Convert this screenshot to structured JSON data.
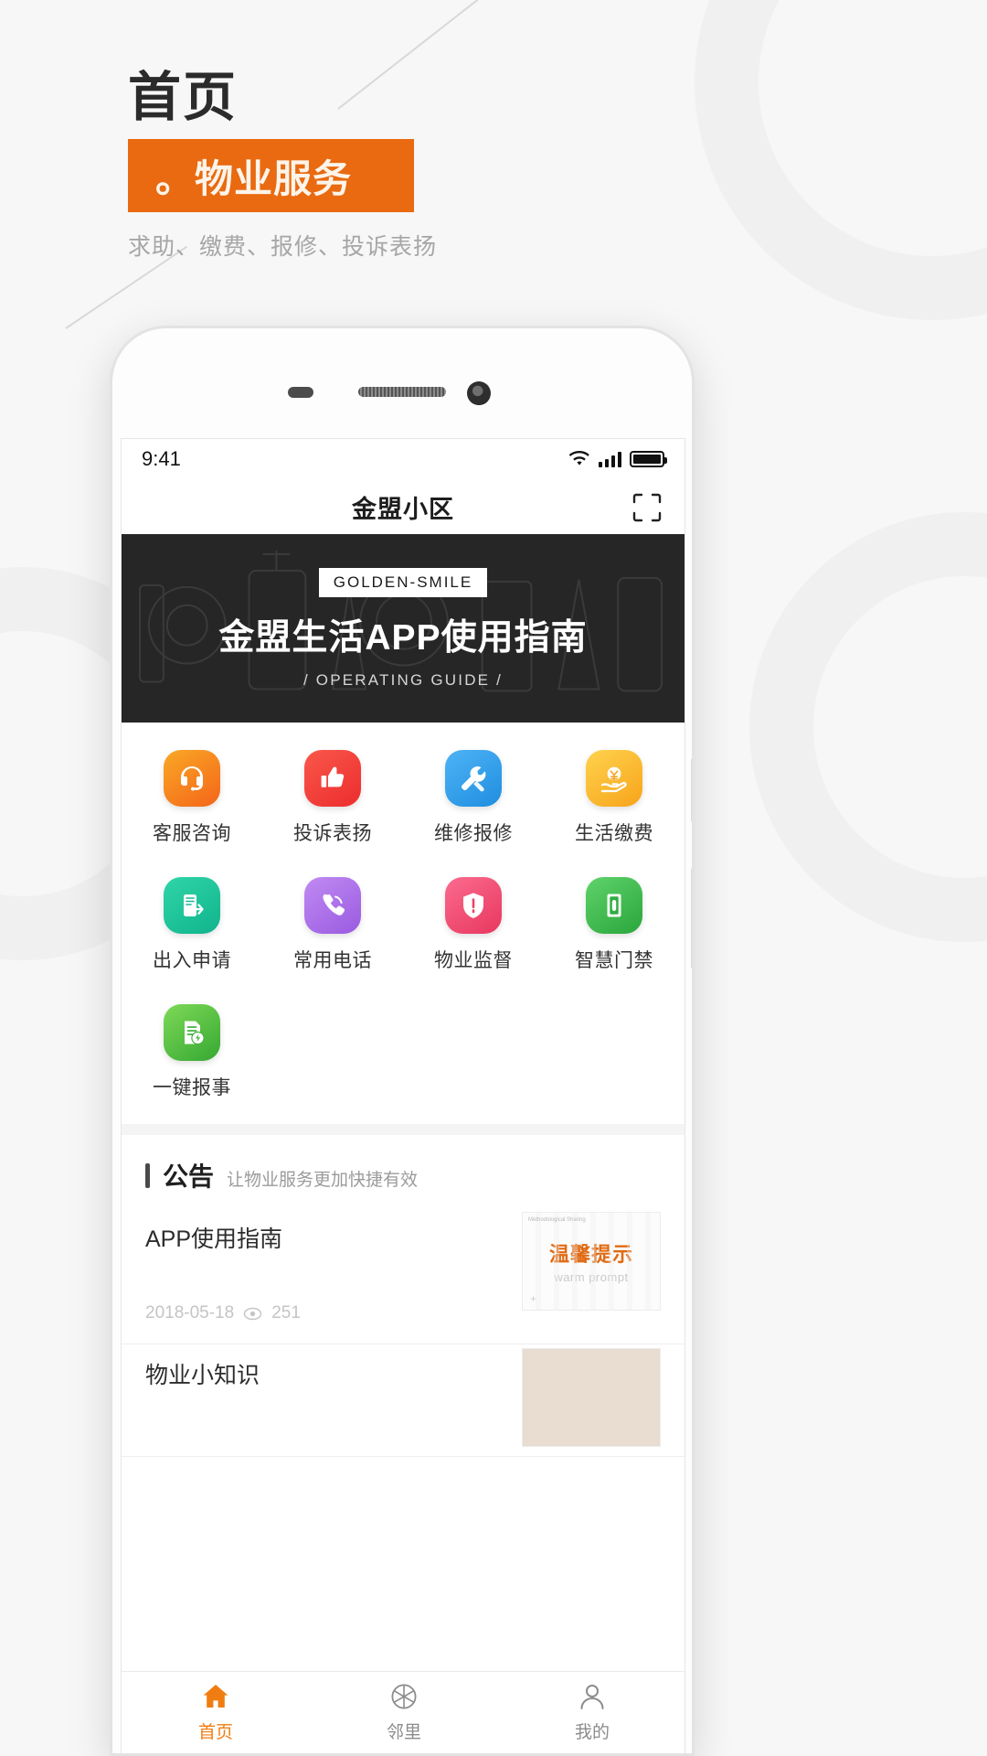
{
  "poster": {
    "title": "首页",
    "band_label": "物业服务",
    "band_bullet": "。",
    "subtitle": "求助、缴费、报修、投诉表扬",
    "accent_color": "#e96a10"
  },
  "statusbar": {
    "time": "9:41",
    "wifi_icon": "wifi-icon",
    "signal_icon": "signal-bars-icon",
    "battery_icon": "battery-full-icon"
  },
  "navbar": {
    "title": "金盟小区",
    "scan_icon": "scan-qr-icon"
  },
  "hero": {
    "badge": "GOLDEN-SMILE",
    "title": "金盟生活APP使用指南",
    "subtitle": "/ OPERATING GUIDE /"
  },
  "grid": [
    {
      "label": "客服咨询",
      "icon": "headset-icon",
      "color1": "#f9a825",
      "color2": "#f4651a"
    },
    {
      "label": "投诉表扬",
      "icon": "thumbs-up-icon",
      "color1": "#f9574a",
      "color2": "#ec2d2d"
    },
    {
      "label": "维修报修",
      "icon": "wrench-icon",
      "color1": "#4eb3f5",
      "color2": "#1f8ee0"
    },
    {
      "label": "生活缴费",
      "icon": "money-hand-icon",
      "color1": "#ffd24d",
      "color2": "#f7a41b"
    },
    {
      "label": "出入申请",
      "icon": "door-pass-icon",
      "color1": "#2fd6a8",
      "color2": "#11b38c"
    },
    {
      "label": "常用电话",
      "icon": "phone-call-icon",
      "color1": "#c08af2",
      "color2": "#9a5be0"
    },
    {
      "label": "物业监督",
      "icon": "shield-alert-icon",
      "color1": "#fb6b8e",
      "color2": "#e8375f"
    },
    {
      "label": "智慧门禁",
      "icon": "door-access-icon",
      "color1": "#5fd36a",
      "color2": "#2aa63c"
    },
    {
      "label": "一键报事",
      "icon": "report-bolt-icon",
      "color1": "#7ed957",
      "color2": "#35a832"
    }
  ],
  "notice": {
    "title": "公告",
    "subtitle": "让物业服务更加快捷有效",
    "items": [
      {
        "title": "APP使用指南",
        "date": "2018-05-18",
        "views": "251",
        "views_icon": "eye-icon",
        "thumb": {
          "tag": "Methodological\nSharing",
          "main": "温馨提示",
          "en": "warm prompt",
          "plus": "+"
        }
      },
      {
        "title": "物业小知识"
      }
    ]
  },
  "tabbar": [
    {
      "label": "首页",
      "icon": "home-icon",
      "active": true
    },
    {
      "label": "邻里",
      "icon": "camera-aperture-icon",
      "active": false
    },
    {
      "label": "我的",
      "icon": "person-icon",
      "active": false
    }
  ]
}
